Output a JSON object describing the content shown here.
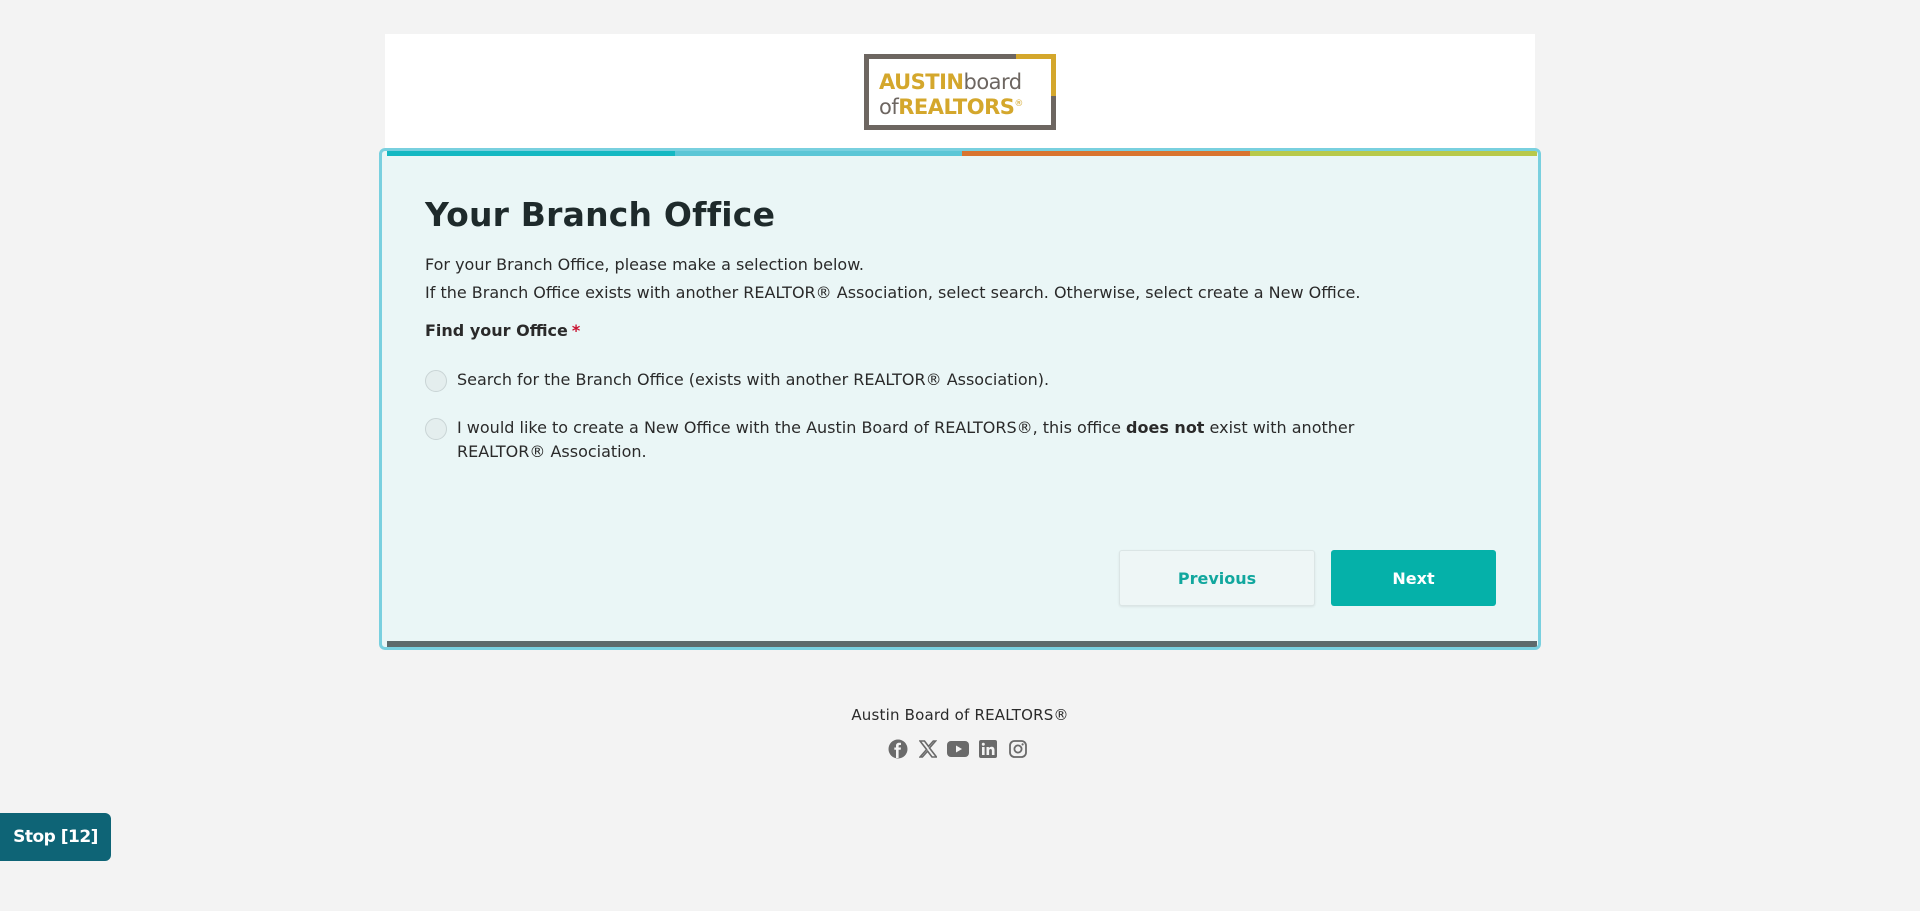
{
  "logo": {
    "line1_a": "AUSTIN",
    "line1_b": "board",
    "line2_a": "of",
    "line2_b": "REALTORS",
    "reg": "®"
  },
  "progress": {
    "colors": [
      "#14b8c2",
      "#5bc6d6",
      "#d9742f",
      "#b8c94a"
    ],
    "step": 1,
    "total": 4
  },
  "form": {
    "title": "Your Branch Office",
    "intro_line1": "For your Branch Office, please make a selection below.",
    "intro_line2": "If the Branch Office exists with another REALTOR® Association, select search. Otherwise, select create a New Office.",
    "field_label": "Find your Office",
    "required_marker": "*",
    "options": [
      {
        "label": "Search for the Branch Office (exists with another REALTOR® Association).",
        "selected": false
      },
      {
        "label_before": "I would like to create a New Office with the Austin Board of REALTORS®, this office ",
        "label_bold": "does not",
        "label_after": " exist with another REALTOR® Association.",
        "selected": false
      }
    ],
    "previous_label": "Previous",
    "next_label": "Next"
  },
  "footer": {
    "org_name": "Austin Board of REALTORS®",
    "social_icons": [
      "facebook-icon",
      "x-icon",
      "youtube-icon",
      "linkedin-icon",
      "instagram-icon"
    ]
  },
  "stop_button": {
    "label": "Stop [12]"
  },
  "colors": {
    "accent": "#05b1a9",
    "card_border": "#79d0df",
    "card_bg": "#eaf6f6",
    "required": "#c8102e",
    "stop_bg": "#0e6476"
  }
}
